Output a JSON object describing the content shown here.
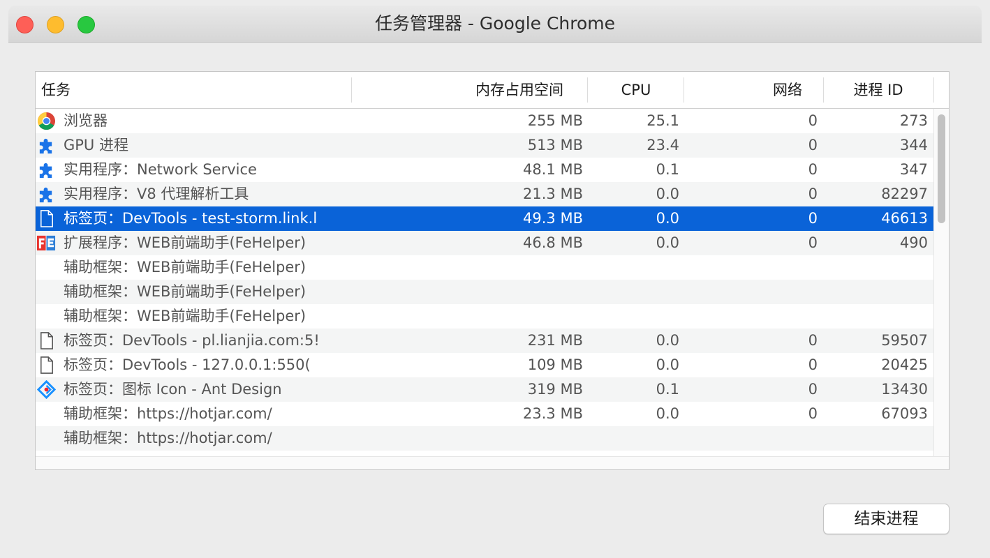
{
  "window": {
    "title": "任务管理器 - Google Chrome"
  },
  "table": {
    "columns": {
      "task": "任务",
      "memory": "内存占用空间",
      "cpu": "CPU",
      "network": "网络",
      "pid": "进程 ID"
    },
    "rows": [
      {
        "icon": "chrome-icon",
        "task": "浏览器",
        "memory": "255 MB",
        "cpu": "25.1",
        "network": "0",
        "pid": "273"
      },
      {
        "icon": "puzzle-icon",
        "task": "GPU 进程",
        "memory": "513 MB",
        "cpu": "23.4",
        "network": "0",
        "pid": "344"
      },
      {
        "icon": "puzzle-icon",
        "task": "实用程序：Network Service",
        "memory": "48.1 MB",
        "cpu": "0.1",
        "network": "0",
        "pid": "347"
      },
      {
        "icon": "puzzle-icon",
        "task": "实用程序：V8 代理解析工具",
        "memory": "21.3 MB",
        "cpu": "0.0",
        "network": "0",
        "pid": "82297"
      },
      {
        "icon": "page-icon",
        "task": "标签页：DevTools - test-storm.link.l",
        "memory": "49.3 MB",
        "cpu": "0.0",
        "network": "0",
        "pid": "46613",
        "selected": true
      },
      {
        "icon": "fe-helper-icon",
        "task": "扩展程序：WEB前端助手(FeHelper)",
        "memory": "46.8 MB",
        "cpu": "0.0",
        "network": "0",
        "pid": "490"
      },
      {
        "icon": "",
        "task": "辅助框架：WEB前端助手(FeHelper)",
        "memory": "",
        "cpu": "",
        "network": "",
        "pid": ""
      },
      {
        "icon": "",
        "task": "辅助框架：WEB前端助手(FeHelper)",
        "memory": "",
        "cpu": "",
        "network": "",
        "pid": ""
      },
      {
        "icon": "",
        "task": "辅助框架：WEB前端助手(FeHelper)",
        "memory": "",
        "cpu": "",
        "network": "",
        "pid": ""
      },
      {
        "icon": "page-icon",
        "task": "标签页：DevTools - pl.lianjia.com:5!",
        "memory": "231 MB",
        "cpu": "0.0",
        "network": "0",
        "pid": "59507"
      },
      {
        "icon": "page-icon",
        "task": "标签页：DevTools - 127.0.0.1:550(",
        "memory": "109 MB",
        "cpu": "0.0",
        "network": "0",
        "pid": "20425"
      },
      {
        "icon": "ant-design-icon",
        "task": "标签页：图标 Icon - Ant Design",
        "memory": "319 MB",
        "cpu": "0.1",
        "network": "0",
        "pid": "13430"
      },
      {
        "icon": "",
        "task": "辅助框架：https://hotjar.com/",
        "memory": "23.3 MB",
        "cpu": "0.0",
        "network": "0",
        "pid": "67093"
      },
      {
        "icon": "",
        "task": "辅助框架：https://hotjar.com/",
        "memory": "",
        "cpu": "",
        "network": "",
        "pid": ""
      }
    ]
  },
  "buttons": {
    "end_process": "结束进程"
  },
  "colors": {
    "selection": "#0a63d8",
    "close": "#fe5f57",
    "minimize": "#febc2e",
    "maximize": "#28c840"
  }
}
